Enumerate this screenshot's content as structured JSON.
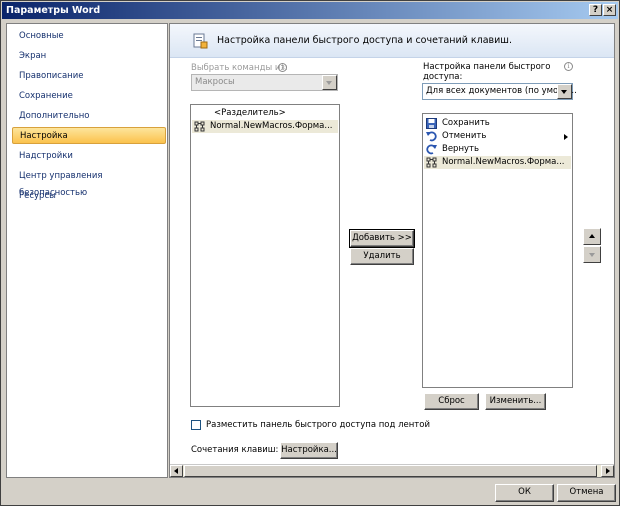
{
  "window": {
    "title": "Параметры Word",
    "help_glyph": "?",
    "close_glyph": "×"
  },
  "sidebar": {
    "items": [
      {
        "label": "Основные"
      },
      {
        "label": "Экран"
      },
      {
        "label": "Правописание"
      },
      {
        "label": "Сохранение"
      },
      {
        "label": "Дополнительно"
      },
      {
        "label": "Настройка",
        "active": true
      },
      {
        "label": "Надстройки"
      },
      {
        "label": "Центр управления безопасностью"
      },
      {
        "label": "Ресурсы"
      }
    ]
  },
  "header": {
    "title": "Настройка панели быстрого доступа и сочетаний клавиш."
  },
  "left": {
    "choose_label": "Выбрать команды из:",
    "choose_value": "Макросы",
    "items": [
      {
        "label": "<Разделитель>",
        "icon": "none"
      },
      {
        "label": "Normal.NewMacros.Форма...",
        "icon": "macro-icon",
        "selected": true
      }
    ]
  },
  "right": {
    "config_label_line1": "Настройка панели быстрого",
    "config_label_line2": "доступа:",
    "config_value": "Для всех документов (по умолч...",
    "items": [
      {
        "label": "Сохранить",
        "icon": "save-icon"
      },
      {
        "label": "Отменить",
        "icon": "undo-icon",
        "submenu": true
      },
      {
        "label": "Вернуть",
        "icon": "redo-icon"
      },
      {
        "label": "Normal.NewMacros.Форма...",
        "icon": "macro-icon",
        "selected": true
      }
    ],
    "reset_label": "Сброс",
    "modify_label": "Изменить..."
  },
  "middle": {
    "add_label": "Добавить >>",
    "remove_label": "Удалить"
  },
  "bottom": {
    "checkbox_label": "Разместить панель быстрого доступа под лентой",
    "checkbox_checked": false,
    "shortcuts_label": "Сочетания клавиш:",
    "shortcuts_button": "Настройка..."
  },
  "footer": {
    "ok_label": "ОК",
    "cancel_label": "Отмена"
  },
  "info_glyph": "i"
}
